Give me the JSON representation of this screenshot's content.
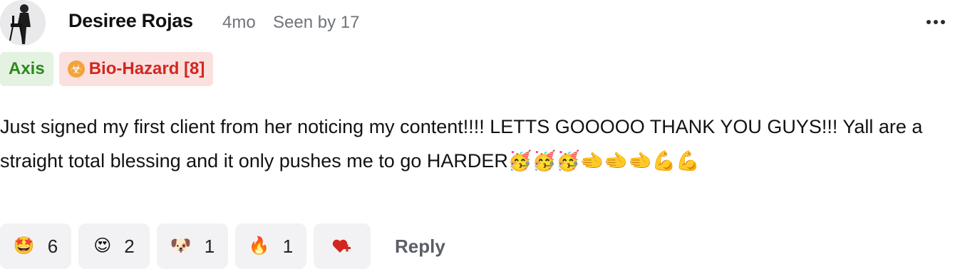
{
  "post": {
    "author": "Desiree Rojas",
    "time": "4mo",
    "seen": "Seen by 17",
    "tags": [
      {
        "label": "Axis"
      },
      {
        "label": "Bio-Hazard [8]",
        "icon": "☣"
      }
    ],
    "body": "Just signed my first client from her noticing my content!!!! LETTS GOOOOO THANK YOU GUYS!!! Yall are a straight total blessing and it only pushes me to go HARDER🥳🥳🥳🫲🫲🫲💪💪"
  },
  "reactions": [
    {
      "emoji": "🤩",
      "count": "6"
    },
    {
      "emoji": "😍",
      "count": "2"
    },
    {
      "emoji": "🐶",
      "count": "1"
    },
    {
      "emoji": "🔥",
      "count": "1"
    }
  ],
  "actions": {
    "add_reaction_icon": "❤+",
    "reply_label": "Reply"
  },
  "colors": {
    "axis_tag_bg": "#e4f2e2",
    "axis_tag_text": "#2a8a1a",
    "bio_tag_bg": "#fbe0e0",
    "bio_tag_text": "#d3261f",
    "reply_text": "#5a5e66",
    "add_reaction": "#d3261f"
  }
}
